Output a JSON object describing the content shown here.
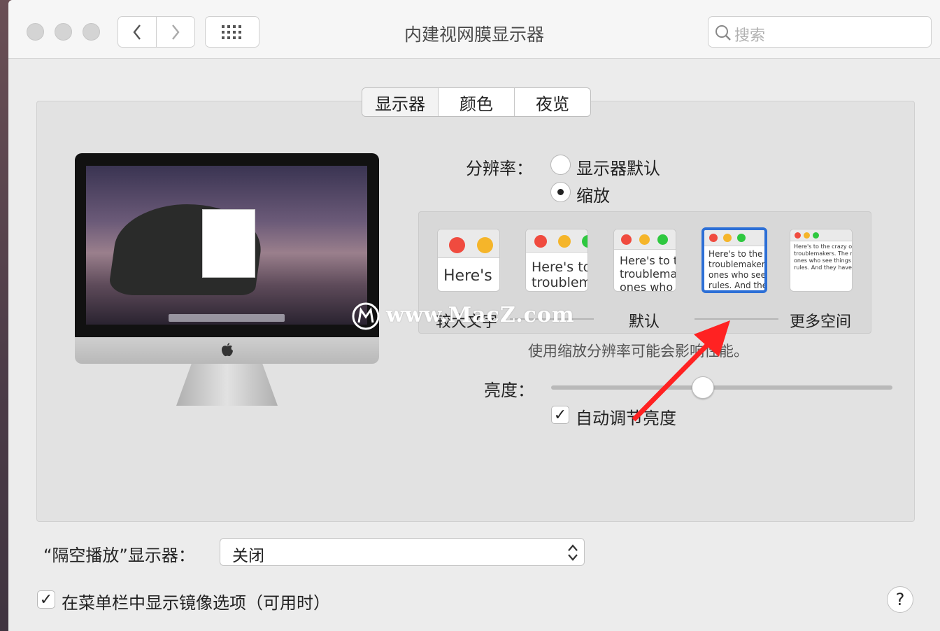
{
  "window": {
    "title": "内建视网膜显示器"
  },
  "search": {
    "placeholder": "搜索"
  },
  "tabs": [
    {
      "label": "显示器",
      "selected": true
    },
    {
      "label": "颜色",
      "selected": false
    },
    {
      "label": "夜览",
      "selected": false
    }
  ],
  "resolution": {
    "label": "分辨率：",
    "options": [
      {
        "label": "显示器默认",
        "checked": false
      },
      {
        "label": "缩放",
        "checked": true
      }
    ]
  },
  "scaled": {
    "thumbs": [
      {
        "line1": "Here's",
        "line2": "",
        "line3": "",
        "line4": ""
      },
      {
        "line1": "Here's to",
        "line2": "troublem",
        "line3": "",
        "line4": ""
      },
      {
        "line1": "Here's to t",
        "line2": "troublema",
        "line3": "ones who",
        "line4": ""
      },
      {
        "line1": "Here's to the cr",
        "line2": "troublemakers.",
        "line3": "ones who see t",
        "line4": "rules. And they"
      },
      {
        "line1": "Here's to the crazy one",
        "line2": "troublemakers. The rou",
        "line3": "ones who see things dif",
        "line4": "rules. And they have no"
      }
    ],
    "selected_index": 3,
    "left_label": "较大文字",
    "middle_label": "默认",
    "right_label": "更多空间"
  },
  "hint": "使用缩放分辨率可能会影响性能。",
  "brightness": {
    "label": "亮度：",
    "level": 0.45
  },
  "auto_brightness": {
    "label": "自动调节亮度",
    "checked": true
  },
  "airplay": {
    "label": "“隔空播放”显示器：",
    "value": "关闭"
  },
  "mirror_option": {
    "label": "在菜单栏中显示镜像选项（可用时）",
    "checked": true
  },
  "help": {
    "label": "?"
  },
  "watermark": "www.MacZ.com"
}
